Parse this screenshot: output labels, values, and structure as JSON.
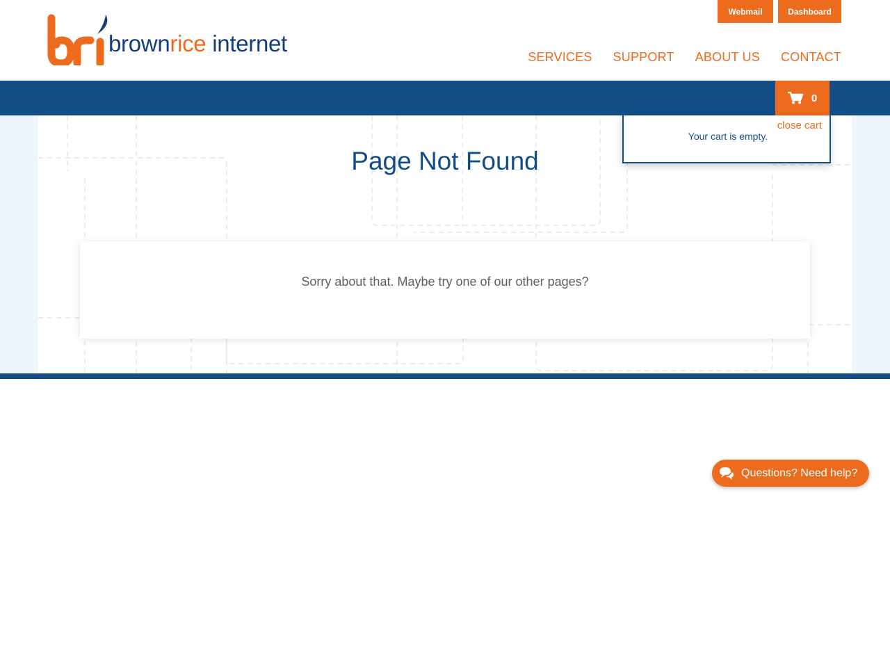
{
  "brand": {
    "part1": "brown",
    "part2": "rice",
    "part3": " internet"
  },
  "top_links": {
    "webmail": "Webmail",
    "dashboard": "Dashboard"
  },
  "nav": {
    "services": "SERVICES",
    "support": "SUPPORT",
    "about": "ABOUT US",
    "contact": "CONTACT"
  },
  "cart": {
    "count": "0",
    "close_label": "close cart",
    "empty_message": "Your cart is empty."
  },
  "main": {
    "title": "Page Not Found",
    "message": "Sorry about that. Maybe try one of our other pages?"
  },
  "help": {
    "label": "Questions? Need help?"
  },
  "colors": {
    "brand_orange": "#ec6b1c",
    "brand_blue": "#134d86",
    "dark_blue": "#123d78",
    "light_bg": "#eef5fd"
  },
  "icons": {
    "cart": "shopping-cart-icon",
    "chat": "chat-bubbles-icon"
  }
}
